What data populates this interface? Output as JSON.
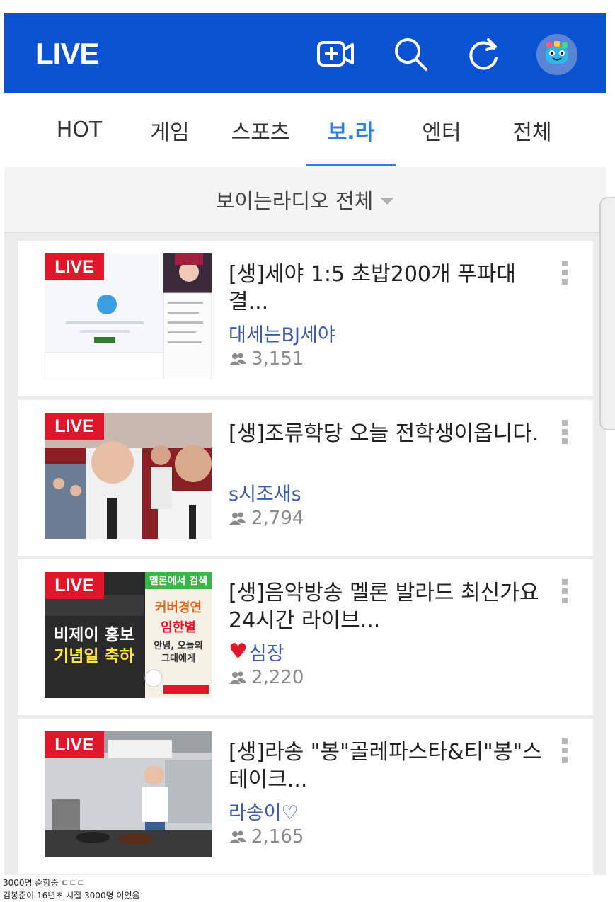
{
  "header": {
    "title": "LIVE",
    "icons": [
      "broadcast-camera-icon",
      "search-icon",
      "refresh-icon",
      "profile-avatar-icon"
    ]
  },
  "tabs": [
    {
      "label": "HOT",
      "active": false
    },
    {
      "label": "게임",
      "active": false
    },
    {
      "label": "스포츠",
      "active": false
    },
    {
      "label": "보.라",
      "active": true
    },
    {
      "label": "엔터",
      "active": false
    },
    {
      "label": "전체",
      "active": false
    }
  ],
  "filter": {
    "label": "보이는라디오 전체"
  },
  "streams": [
    {
      "badge": "LIVE",
      "title": "[생]세야 1:5 초밥200개 푸파대결...",
      "bj": "대세는BJ세야",
      "viewers": "3,151"
    },
    {
      "badge": "LIVE",
      "title": "[생]조류학당 오늘 전학생이옵니다.",
      "bj": "s시조새s",
      "viewers": "2,794"
    },
    {
      "badge": "LIVE",
      "title": "[생]음악방송 멜론 발라드 최신가요 24시간 라이브...",
      "bj": "심장",
      "bj_heart": "♥",
      "viewers": "2,220",
      "thumb_text": {
        "top_banner": "멜론에서 검색",
        "line1": "비제이 홍보",
        "line2": "기념일 축하",
        "right1": "커버경연",
        "right2": "임한별",
        "right3": "안녕, 오늘의",
        "right4": "그대에게"
      }
    },
    {
      "badge": "LIVE",
      "title": "[생]라송 \"봉\"골레파스타&티\"봉\"스테이크...",
      "bj": "라송이♡",
      "viewers": "2,165"
    }
  ],
  "caption": {
    "line1": "3000명 순항중 ㄷㄷㄷ",
    "line2": "김봉준이 16년초 시절 3000명 이었음"
  },
  "colors": {
    "header_bg": "#0b52d1",
    "active_tab": "#2f7ee6",
    "live_badge": "#e0172a",
    "bj_name": "#3e5aa8"
  }
}
